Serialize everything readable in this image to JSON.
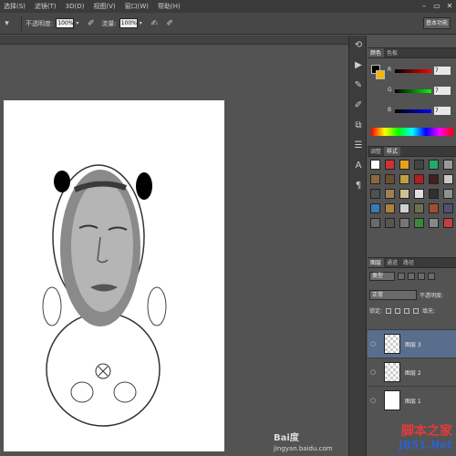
{
  "menubar": {
    "items": [
      "选择(S)",
      "滤镜(T)",
      "3D(D)",
      "视图(V)",
      "窗口(W)",
      "帮助(H)"
    ]
  },
  "options": {
    "opacity_label": "不透明度:",
    "opacity_value": "100%",
    "flow_label": "流量:",
    "flow_value": "100%",
    "workspace_button": "基本功能"
  },
  "color_panel": {
    "tabs": [
      "颜色",
      "色板"
    ],
    "channels": [
      {
        "name": "R",
        "value": "7"
      },
      {
        "name": "G",
        "value": "7"
      },
      {
        "name": "B",
        "value": "7"
      }
    ],
    "foreground": "#000000",
    "background": "#f2b800"
  },
  "styles_panel": {
    "tabs": [
      "调整",
      "样式"
    ],
    "swatches": [
      "#ffffff",
      "#c33",
      "#e8a020",
      "#444",
      "#2a6",
      "#999",
      "#666",
      "#8a6a3a",
      "#6a5030",
      "#c0a040",
      "#b02020",
      "#402020",
      "#c8c8c8",
      "#707070",
      "#505050",
      "#a08050",
      "#d0c090",
      "#e0e0e0",
      "#303030",
      "#909090",
      "#604030",
      "#3a7ab0",
      "#b08040",
      "#d0d0d0",
      "#707050",
      "#a05030",
      "#505070",
      "#202020",
      "#6a6a6a",
      "#555555",
      "#777777",
      "#3a8a3a",
      "#888888",
      "#c04040",
      "#444444"
    ]
  },
  "layers_panel": {
    "tabs": [
      "图层",
      "通道",
      "路径"
    ],
    "kind_label": "类型",
    "blend_mode": "正常",
    "opacity_label": "不透明度:",
    "lock_label": "锁定:",
    "fill_label": "填充:",
    "layers": [
      {
        "name": "图层 3",
        "selected": true,
        "thumb": "checker"
      },
      {
        "name": "图层 2",
        "selected": false,
        "thumb": "checker"
      },
      {
        "name": "图层 1",
        "selected": false,
        "thumb": "white"
      }
    ]
  },
  "watermark": {
    "baidu": "Bai度",
    "url": "jingyan.baidu.com",
    "site_cn": "脚本之家",
    "site_en": "JB51.Net"
  }
}
